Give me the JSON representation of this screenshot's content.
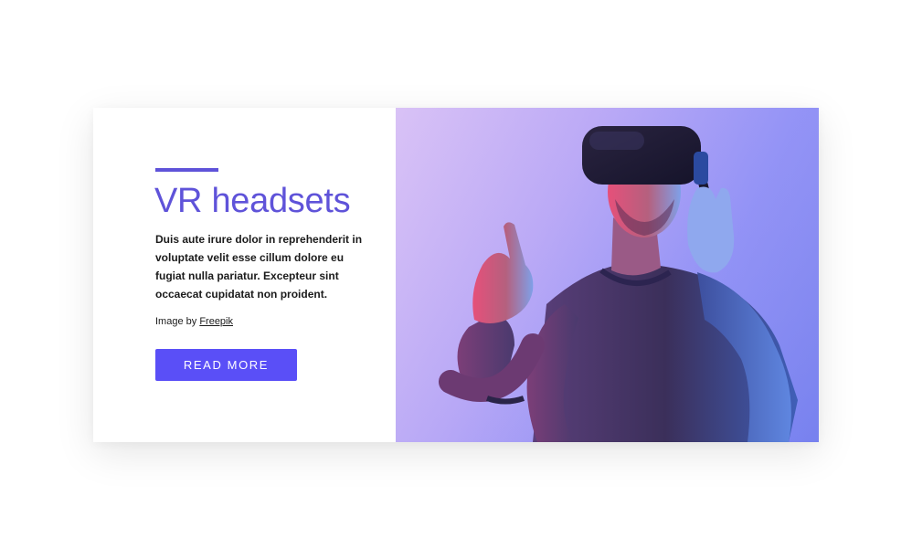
{
  "card": {
    "title": "VR headsets",
    "body": "Duis aute irure dolor in reprehenderit in voluptate velit esse cillum dolore eu fugiat nulla pariatur. Excepteur sint occaecat cupidatat non proident.",
    "credit_prefix": "Image by ",
    "credit_link": "Freepik",
    "button_label": "READ MORE"
  },
  "colors": {
    "accent": "#5f53d9",
    "button": "#5a4ff7",
    "image_gradient_start": "#d9c2f6",
    "image_gradient_end": "#7c84ee"
  },
  "image": {
    "subject": "man-wearing-vr-headset-photo"
  }
}
